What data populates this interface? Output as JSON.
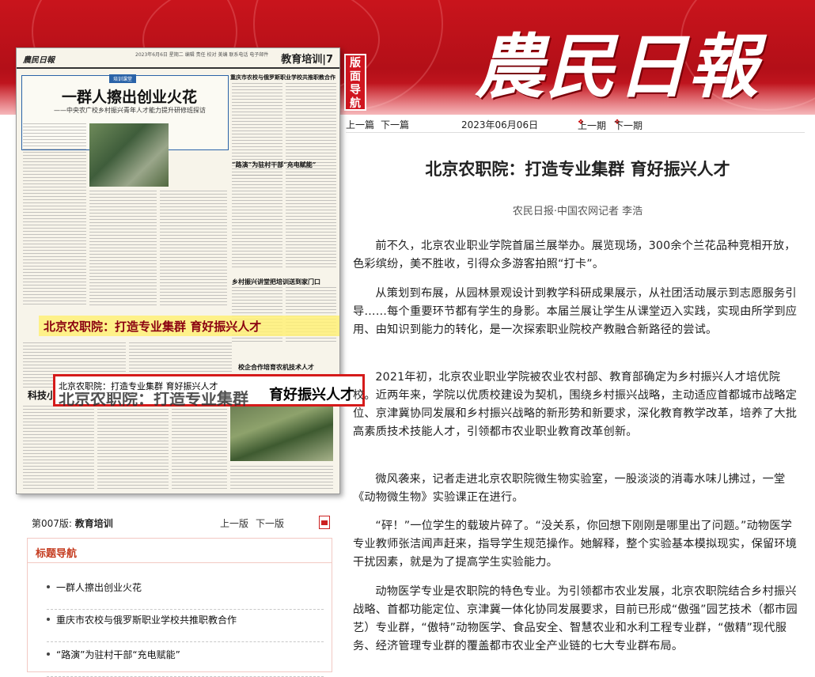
{
  "masthead": "農民日報",
  "seal": "版面导航",
  "paper": {
    "logo": "農民日報",
    "section": "教育培训",
    "page_no": "7",
    "lead_tag": "培训课堂",
    "lead_headline": "一群人擦出创业火花",
    "lead_subhead": "——中央农广校乡村振兴青年人才能力提升研修班探访",
    "right_head1": "重庆市农校与俄罗斯职业学校共推职教合作",
    "right_head2": "“路演”为驻村干部“充电赋能”",
    "right_head3": "乡村振兴讲堂把培训送到家门口",
    "highlight_headline": "北京农职院：打造专业集群  育好振兴人才",
    "lower_right_head": "校企合作培育农机技术人才",
    "lower_left_prefix": "科技小"
  },
  "tooltip": {
    "small": "北京农职院：打造专业集群  育好振兴人才",
    "large": "育好振兴人才",
    "ghost": "北京农职院：打造专业集群"
  },
  "pagebar": {
    "prefix": "第007版:",
    "section": "教育培训",
    "prev": "上一版",
    "next": "下一版"
  },
  "titlenav": {
    "heading": "标题导航",
    "items": [
      "一群人擦出创业火花",
      "重庆市农校与俄罗斯职业学校共推职教合作",
      "“路演”为驻村干部“充电赋能”"
    ]
  },
  "articlenav": {
    "prev_article": "上一篇",
    "next_article": "下一篇",
    "date": "2023年06月06日",
    "prev_issue": "上一期",
    "next_issue": "下一期"
  },
  "article": {
    "title": "北京农职院：打造专业集群    育好振兴人才",
    "author": "农民日报·中国农网记者   李浩",
    "paragraphs": [
      "前不久，北京农业职业学院首届兰展举办。展览现场，300余个兰花品种竞相开放，色彩缤纷，美不胜收，引得众多游客拍照“打卡”。",
      "从策划到布展，从园林景观设计到教学科研成果展示，从社团活动展示到志愿服务引导……每个重要环节都有学生的身影。本届兰展让学生从课堂迈入实践，实现由所学到应用、由知识到能力的转化，是一次探索职业院校产教融合新路径的尝试。",
      "2021年初，北京农业职业学院被农业农村部、教育部确定为乡村振兴人才培优院校。近两年来，学院以优质校建设为契机，围绕乡村振兴战略，主动适应首都城市战略定位、京津冀协同发展和乡村振兴战略的新形势和新要求，深化教育教学改革，培养了大批高素质技术技能人才，引领都市农业职业教育改革创新。",
      "微风袭来，记者走进北京农职院微生物实验室，一股淡淡的消毒水味儿拂过，一堂《动物微生物》实验课正在进行。",
      "“砰！”一位学生的载玻片碎了。“没关系，你回想下刚刚是哪里出了问题。”动物医学专业教师张洁闻声赶来，指导学生规范操作。她解释，整个实验基本模拟现实，保留环境干扰因素，就是为了提高学生实验能力。",
      "动物医学专业是农职院的特色专业。为引领都市农业发展，北京农职院结合乡村振兴战略、首都功能定位、京津冀一体化协同发展要求，目前已形成“傲强”园艺技术（都市园艺）专业群，“傲特”动物医学、食品安全、智慧农业和水利工程专业群，“傲精”现代服务、经济管理专业群的覆盖都市农业全产业链的七大专业群布局。"
    ]
  }
}
